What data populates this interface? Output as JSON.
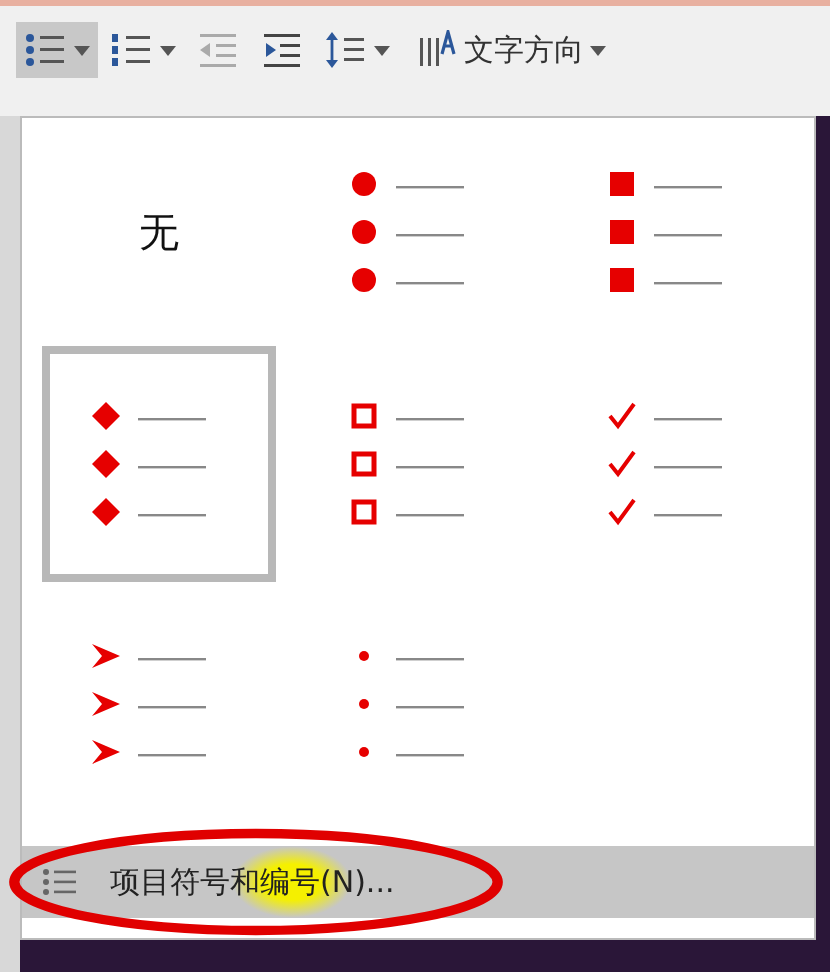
{
  "toolbar": {
    "buttons": [
      {
        "kind": "bullets",
        "selected": true,
        "dropdown": true
      },
      {
        "kind": "numbering",
        "selected": false,
        "dropdown": true
      },
      {
        "kind": "outdent",
        "selected": false,
        "dropdown": false
      },
      {
        "kind": "indent",
        "selected": false,
        "dropdown": false
      },
      {
        "kind": "line-spacing",
        "selected": false,
        "dropdown": true
      }
    ],
    "text_direction": {
      "label": "文字方向"
    }
  },
  "bullet_gallery": {
    "options": [
      {
        "kind": "none",
        "label": "无",
        "selected": false
      },
      {
        "kind": "round",
        "selected": false
      },
      {
        "kind": "square",
        "selected": false
      },
      {
        "kind": "diamond",
        "selected": true
      },
      {
        "kind": "hollow-square",
        "selected": false
      },
      {
        "kind": "check",
        "selected": false
      },
      {
        "kind": "arrow",
        "selected": false
      },
      {
        "kind": "dot",
        "selected": false
      }
    ]
  },
  "menu_item": {
    "label": "项目符号和编号(N)...",
    "highlighted": true
  }
}
